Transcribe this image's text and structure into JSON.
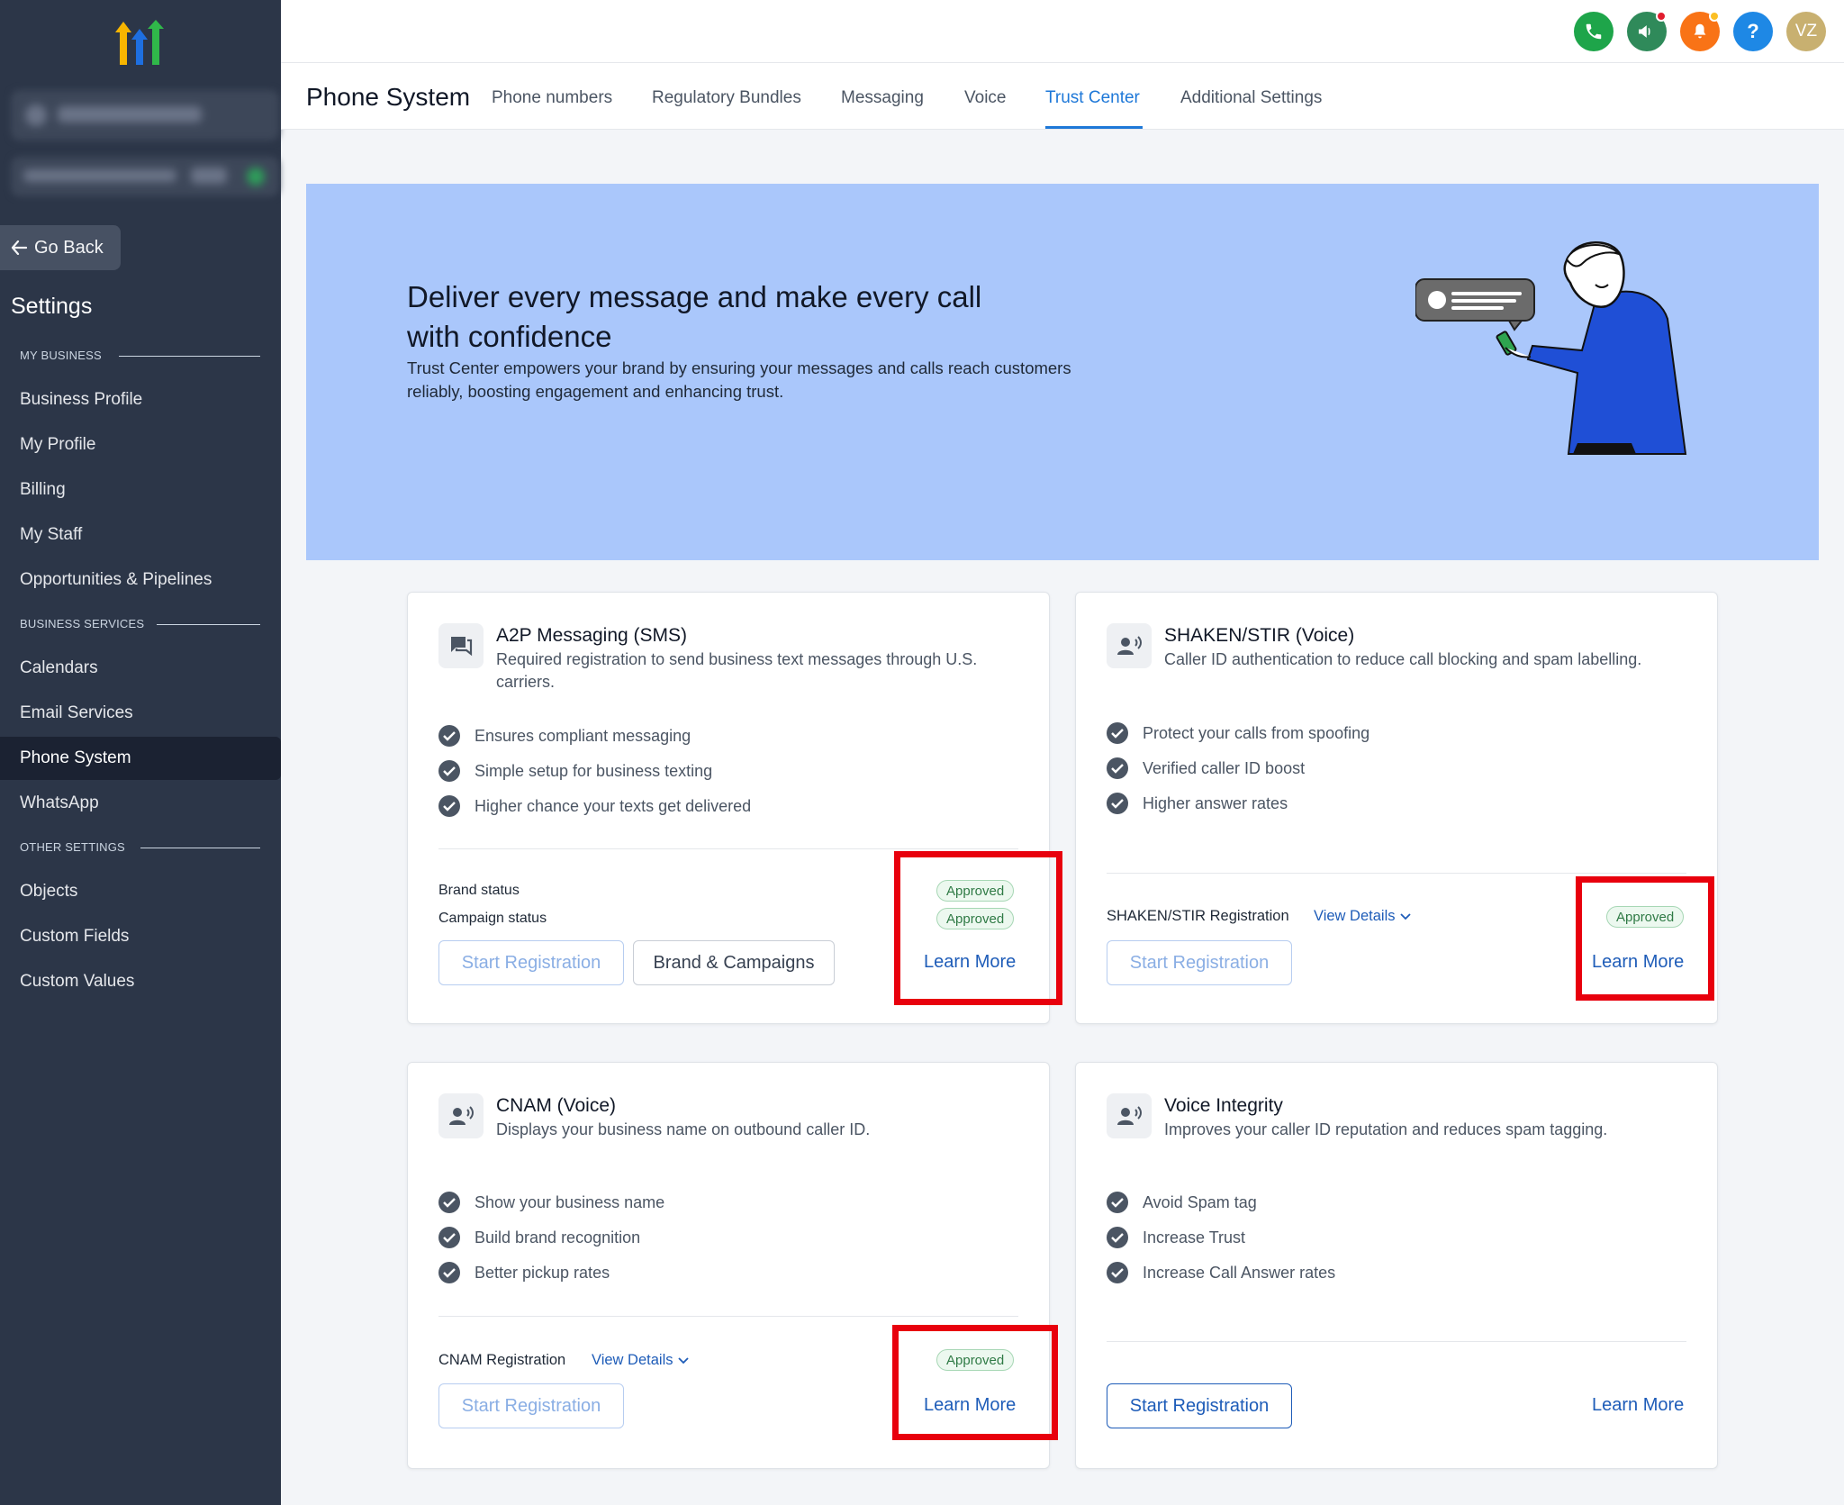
{
  "sidebar": {
    "go_back": "Go Back",
    "title": "Settings",
    "sections": {
      "my_business": "MY BUSINESS",
      "business_services": "BUSINESS SERVICES",
      "other_settings": "OTHER SETTINGS"
    },
    "items": [
      {
        "label": "Business Profile"
      },
      {
        "label": "My Profile"
      },
      {
        "label": "Billing"
      },
      {
        "label": "My Staff"
      },
      {
        "label": "Opportunities & Pipelines"
      },
      {
        "label": "Calendars"
      },
      {
        "label": "Email Services"
      },
      {
        "label": "Phone System",
        "active": true
      },
      {
        "label": "WhatsApp"
      },
      {
        "label": "Objects"
      },
      {
        "label": "Custom Fields"
      },
      {
        "label": "Custom Values"
      }
    ]
  },
  "topbar": {
    "icons": [
      "phone-icon",
      "megaphone-icon",
      "bell-icon",
      "help-icon"
    ],
    "help_label": "?",
    "avatar_initials": "VZ",
    "colors": {
      "phone": "#1ea54a",
      "megaphone": "#2f8a5a",
      "bell": "#f97316",
      "help": "#1e88e5",
      "avatar": "#c8b070"
    }
  },
  "header": {
    "title": "Phone System",
    "tabs": [
      {
        "label": "Phone numbers"
      },
      {
        "label": "Regulatory Bundles"
      },
      {
        "label": "Messaging"
      },
      {
        "label": "Voice"
      },
      {
        "label": "Trust Center",
        "active": true
      },
      {
        "label": "Additional Settings"
      }
    ]
  },
  "banner": {
    "title": "Deliver every message and make every call with confidence",
    "description": "Trust Center empowers your brand by ensuring your messages and calls reach customers reliably, boosting engagement and enhancing trust.",
    "color": "#aac7fb"
  },
  "cards": {
    "a2p": {
      "icon": "chat-icon",
      "title": "A2P Messaging (SMS)",
      "description": "Required registration to send business text messages through U.S. carriers.",
      "features": [
        "Ensures compliant messaging",
        "Simple setup for business texting",
        "Higher chance your texts get delivered"
      ],
      "brand_status_label": "Brand status",
      "campaign_status_label": "Campaign status",
      "brand_status": "Approved",
      "campaign_status": "Approved",
      "start_registration": "Start Registration",
      "brand_campaigns": "Brand & Campaigns",
      "learn_more": "Learn More"
    },
    "shaken": {
      "icon": "voice-user-icon",
      "title": "SHAKEN/STIR (Voice)",
      "description": "Caller ID authentication to reduce call blocking and spam labelling.",
      "features": [
        "Protect your calls from spoofing",
        "Verified caller ID boost",
        "Higher answer rates"
      ],
      "registration_label": "SHAKEN/STIR Registration",
      "view_details": "View Details",
      "status": "Approved",
      "start_registration": "Start Registration",
      "learn_more": "Learn More"
    },
    "cnam": {
      "icon": "voice-user-icon",
      "title": "CNAM (Voice)",
      "description": "Displays your business name on outbound caller ID.",
      "features": [
        "Show your business name",
        "Build brand recognition",
        "Better pickup rates"
      ],
      "registration_label": "CNAM Registration",
      "view_details": "View Details",
      "status": "Approved",
      "start_registration": "Start Registration",
      "learn_more": "Learn More"
    },
    "voice_integrity": {
      "icon": "voice-user-icon",
      "title": "Voice Integrity",
      "description": "Improves your caller ID reputation and reduces spam tagging.",
      "features": [
        "Avoid Spam tag",
        "Increase Trust",
        "Increase Call Answer rates"
      ],
      "start_registration": "Start Registration",
      "learn_more": "Learn More"
    }
  },
  "colors": {
    "accent": "#1e78d8",
    "highlight": "#e8000d",
    "approved": "#2f7a45"
  }
}
